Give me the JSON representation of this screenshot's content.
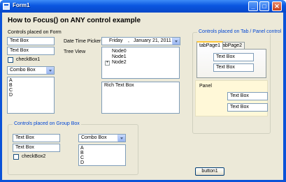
{
  "window": {
    "title": "Form1",
    "minimize_glyph": "_",
    "maximize_glyph": "□",
    "close_glyph": "✕"
  },
  "heading": "How to Focus() on ANY control example",
  "form_controls": {
    "label": "Controls placed on Form",
    "textbox1": "Text Box",
    "textbox2": "Text Box",
    "checkbox": "checkBox1",
    "combo": "Combo Box",
    "list_items": [
      "A",
      "B",
      "C",
      "D"
    ]
  },
  "datetime": {
    "label": "Date Time Picker",
    "weekday": "Friday",
    "sep": ",",
    "month": "January",
    "day_year": "21, 2011"
  },
  "treeview": {
    "label": "Tree View",
    "nodes": [
      "Node0",
      "Node1",
      "Node2"
    ],
    "expander": "+"
  },
  "richtext": "Rich Text Box",
  "group_box": {
    "title": "Controls placed on Group Box",
    "textbox1": "Text Box",
    "textbox2": "Text Box",
    "checkbox": "checkBox2",
    "combo": "Combo Box",
    "list_items": [
      "A",
      "B",
      "C",
      "D"
    ]
  },
  "tab_panel": {
    "title": "Controls placed on Tab / Panel control",
    "tabs": [
      "tabPage1",
      "tabPage2"
    ],
    "tab_textbox1": "Text Box",
    "tab_textbox2": "Text Box",
    "panel_label": "Panel",
    "panel_textbox1": "Text Box",
    "panel_textbox2": "Text Box"
  },
  "button1": "button1",
  "colors": {
    "title_bar": "#0a56e0",
    "client_bg": "#ece9d8",
    "group_title": "#0046d5",
    "panel_bg": "#fff8d8"
  }
}
